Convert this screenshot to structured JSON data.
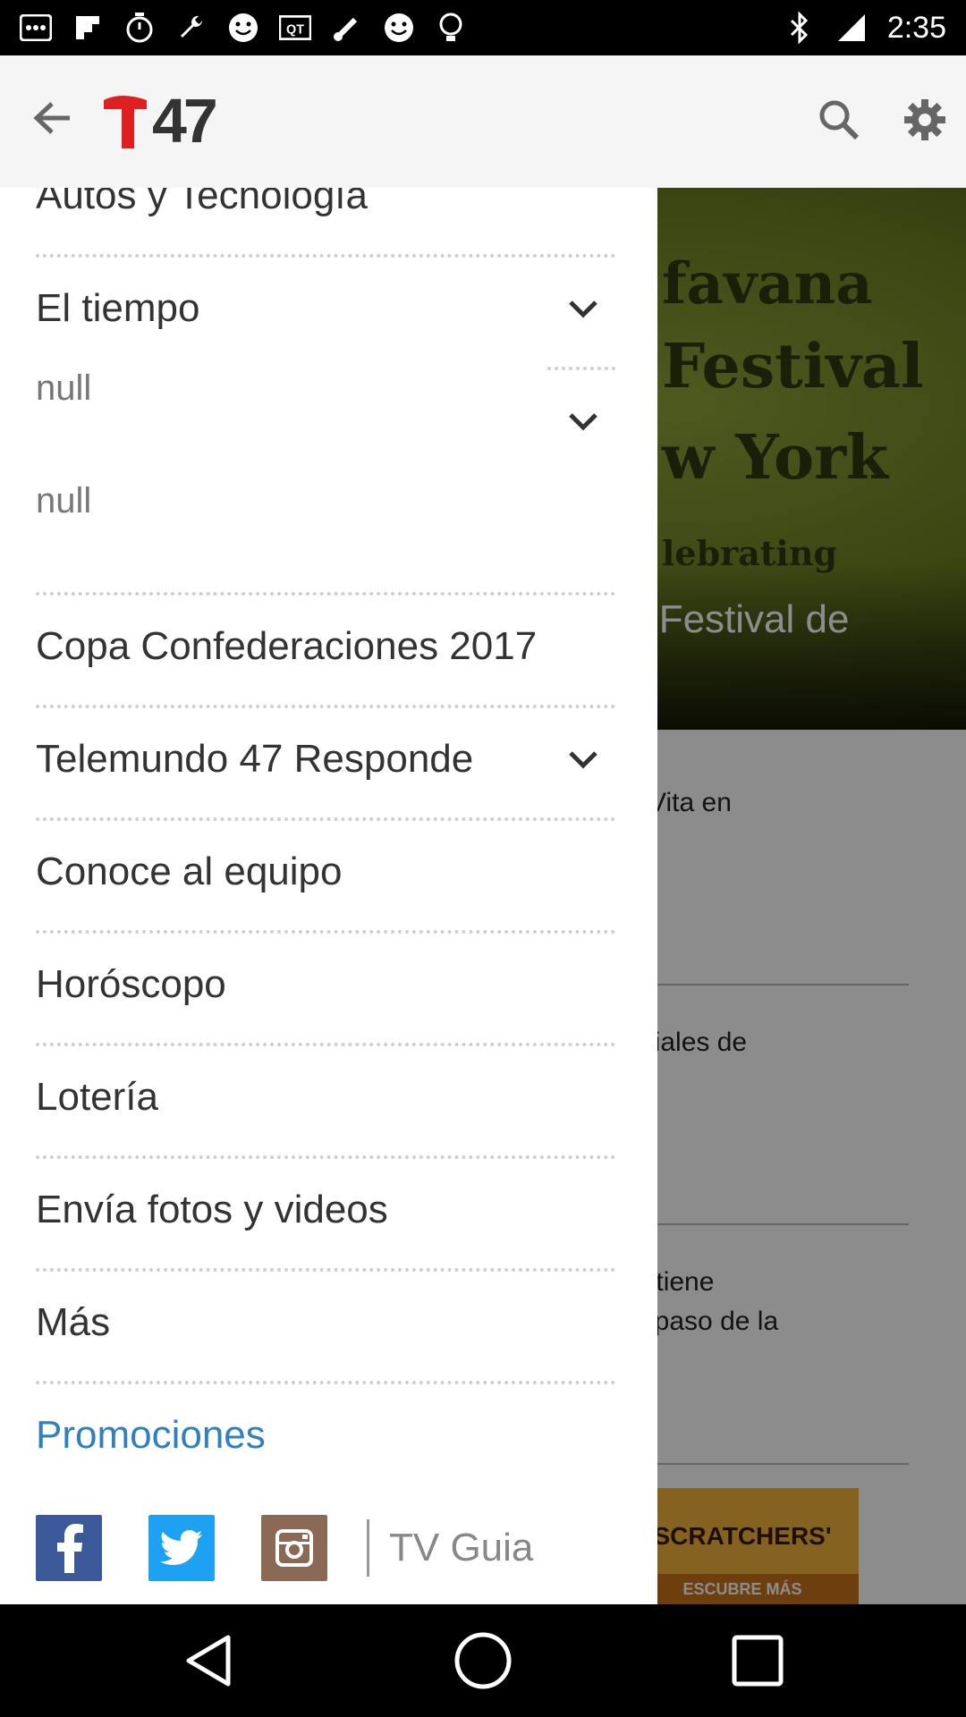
{
  "status_bar": {
    "time": "2:35",
    "left_icons": [
      "notification-icon",
      "flipboard-icon",
      "timer-icon",
      "wrench-icon",
      "smiley-icon",
      "qt-icon",
      "thermometer-icon",
      "smiley-icon",
      "lightbulb-icon"
    ],
    "right_icons": [
      "bluetooth-icon",
      "signal-icon"
    ]
  },
  "app_bar": {
    "logo_text": "47",
    "logo_mark_color": "#e02020"
  },
  "drawer": {
    "items": [
      {
        "label": "Autos y Tecnología",
        "type": "item"
      },
      {
        "label": "El tiempo",
        "type": "expandable"
      },
      {
        "label": "null",
        "type": "sub"
      },
      {
        "label": "null",
        "type": "sub"
      },
      {
        "label": "Copa Confederaciones 2017",
        "type": "item"
      },
      {
        "label": "Telemundo 47 Responde",
        "type": "expandable"
      },
      {
        "label": "Conoce al equipo",
        "type": "item"
      },
      {
        "label": "Horóscopo",
        "type": "item"
      },
      {
        "label": "Lotería",
        "type": "item"
      },
      {
        "label": "Envía fotos y videos",
        "type": "item"
      },
      {
        "label": "Más",
        "type": "item"
      },
      {
        "label": "Promociones",
        "type": "promo"
      }
    ],
    "social": {
      "facebook": "facebook-icon",
      "twitter": "twitter-icon",
      "instagram": "instagram-icon",
      "tv_guide_label": "TV Guia"
    },
    "promo_color": "#2f7fc1"
  },
  "background": {
    "hero_lines": [
      "favana",
      "Festival",
      "w York",
      "lebrating",
      "n Festival de"
    ],
    "articles": [
      {
        "lines": [
          "e Vita en"
        ]
      },
      {
        "lines": [
          "nciales de"
        ]
      },
      {
        "lines": [
          "antiene",
          "el paso de la"
        ]
      }
    ],
    "ad": {
      "top": "SCRATCHERS'",
      "bottom": "ESCUBRE MÁS"
    }
  }
}
